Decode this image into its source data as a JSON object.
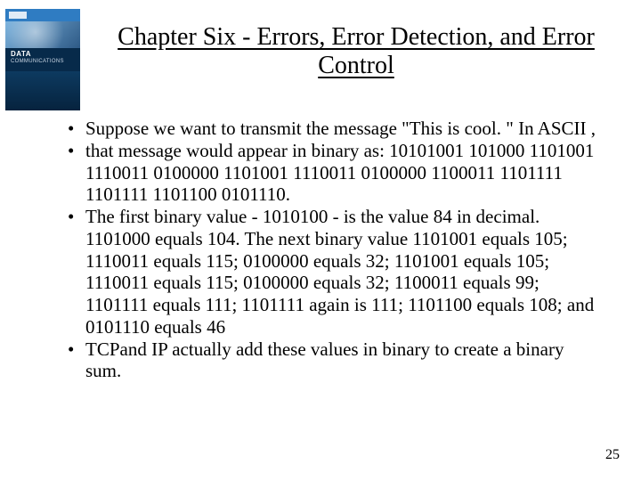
{
  "cover": {
    "line1": "DATA",
    "line2": "COMMUNICATIONS"
  },
  "title": "Chapter Six - Errors, Error Detection, and Error Control",
  "bullets": [
    "Suppose we want to transmit the message \"This is cool. \" In ASCII ,",
    "that message would appear in binary as: 10101001 101000 1101001 1110011 0100000 1101001 1110011 0100000 1100011 1101111 1101111 1101100 0101110.",
    "The first binary value - 1010100 - is the value 84 in decimal. 1101000 equals 104. The next binary value 1101001 equals 105; 1110011 equals 115; 0100000 equals 32; 1101001 equals 105; 1110011 equals 115; 0100000 equals 32; 1100011 equals 99; 1101111 equals 111; 1101111 again is 111; 1101100 equals 108; and 0101110 equals 46",
    "TCPand IP actually add these values in binary to create a binary sum."
  ],
  "page_number": "25"
}
